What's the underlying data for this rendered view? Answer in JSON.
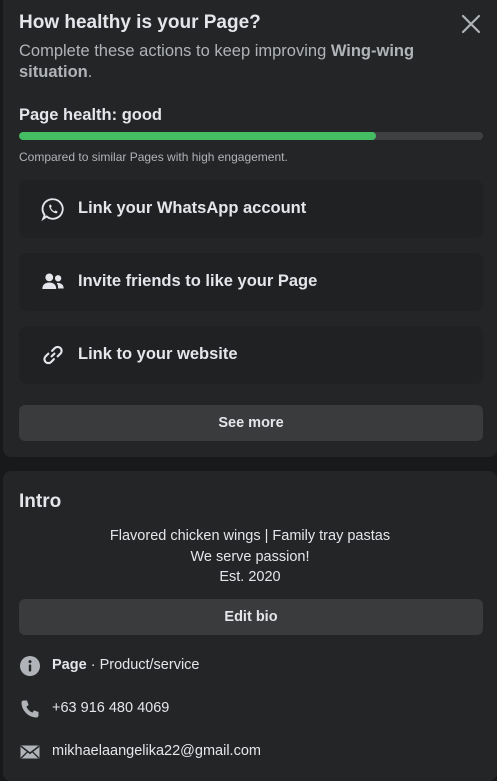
{
  "health": {
    "title": "How healthy is your Page?",
    "subtitle_prefix": "Complete these actions to keep improving ",
    "page_name": "Wing-wing situation",
    "subtitle_suffix": ".",
    "status_label": "Page health: good",
    "progress": 0.77,
    "compare_text": "Compared to similar Pages with high engagement.",
    "actions": [
      {
        "label": "Link your WhatsApp account",
        "icon": "whatsapp-icon"
      },
      {
        "label": "Invite friends to like your Page",
        "icon": "friends-icon"
      },
      {
        "label": "Link to your website",
        "icon": "link-icon"
      }
    ],
    "see_more_label": "See more"
  },
  "intro": {
    "title": "Intro",
    "bio_lines": [
      "Flavored chicken wings | Family tray pastas",
      "We serve passion!",
      "Est. 2020"
    ],
    "edit_bio_label": "Edit bio",
    "category_label": "Page",
    "category_sep": " · ",
    "category_value": "Product/service",
    "phone": "+63 916 480 4069",
    "email": "mikhaelaangelika22@gmail.com"
  },
  "colors": {
    "background": "#18191a",
    "card": "#242526",
    "progress": "#45bd62",
    "button": "#3a3b3c"
  }
}
